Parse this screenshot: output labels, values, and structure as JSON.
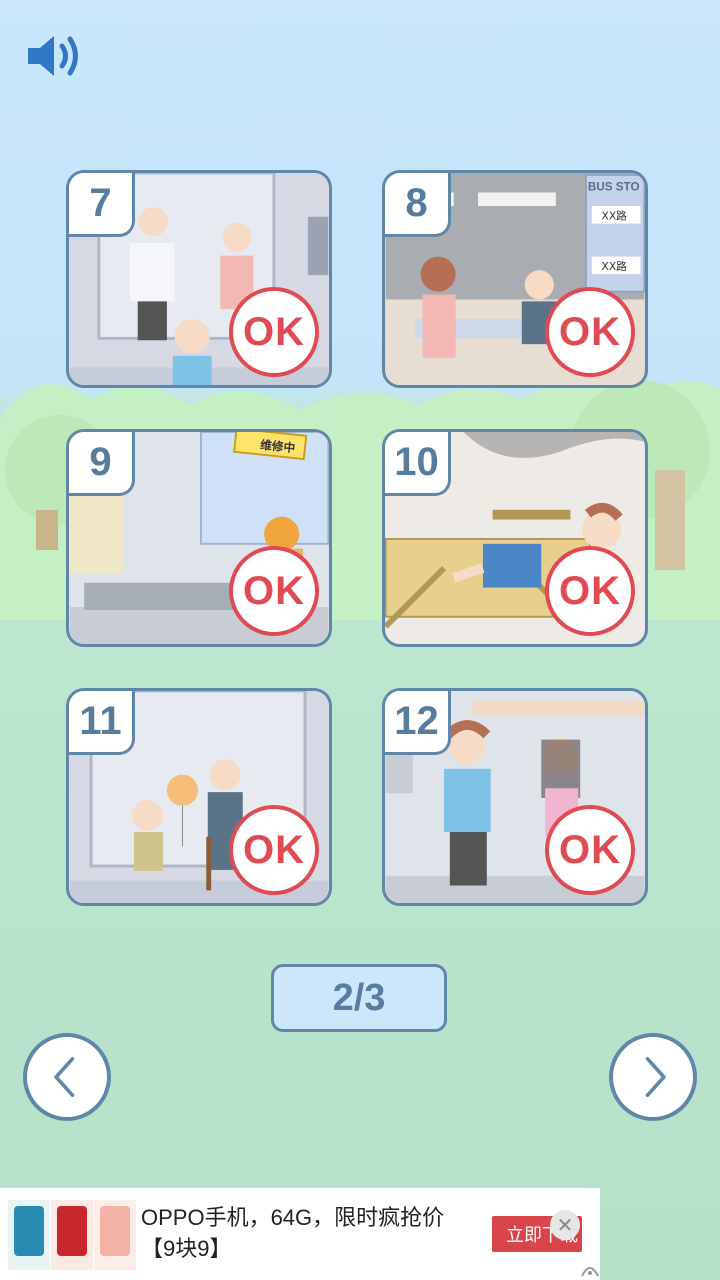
{
  "levels": [
    {
      "number": "7",
      "status": "OK"
    },
    {
      "number": "8",
      "status": "OK"
    },
    {
      "number": "9",
      "status": "OK"
    },
    {
      "number": "10",
      "status": "OK"
    },
    {
      "number": "11",
      "status": "OK"
    },
    {
      "number": "12",
      "status": "OK"
    }
  ],
  "scene_text": {
    "level8_sign_title": "BUS STO",
    "level8_route_1": "XX路",
    "level8_route_2": "XX路",
    "level9_sign": "维修中"
  },
  "pagination": {
    "current_page": 2,
    "total_pages": 3,
    "label": "2/3"
  },
  "icons": {
    "sound": "speaker-volume-icon",
    "prev": "chevron-left-icon",
    "next": "chevron-right-icon",
    "close": "close-icon"
  },
  "ad": {
    "title": "OPPO手机，64G，限时疯抢价",
    "subtitle": "【9块9】",
    "cta_label": "立即下载",
    "close_glyph": "✕"
  },
  "colors": {
    "accent_blue": "#5f87a8",
    "ok_red": "#e04a52",
    "ad_button": "#d9444b"
  }
}
